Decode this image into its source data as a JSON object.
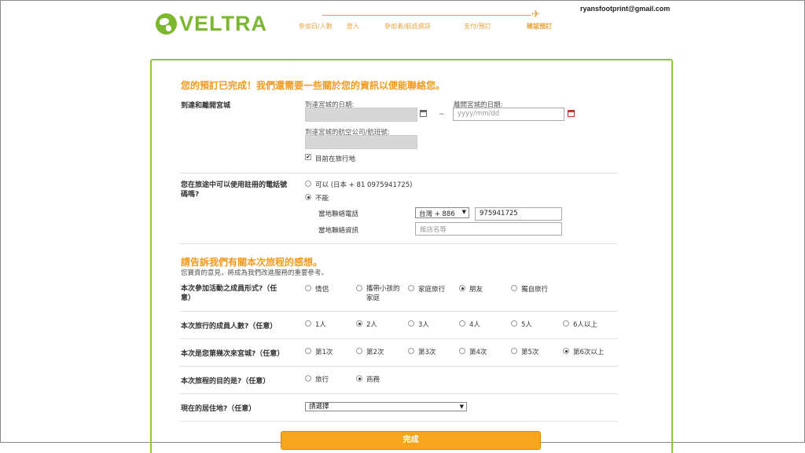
{
  "brand": {
    "logo_text": "VELTRA"
  },
  "user": {
    "email": "ryansfootprint@gmail.com"
  },
  "steps": [
    "參加日/人數",
    "登入",
    "參加者/航班資訊",
    "支付/預訂",
    "確認預訂"
  ],
  "section1": {
    "title": "您的預訂已完成！我們還需要一些關於您的資訊以便能聯絡您。",
    "arrival_label": "到達和離開宮城",
    "arrival_date_label": "到達宮城的日期:",
    "tilde": "~",
    "departure_date_label": "離開宮城的日期:",
    "departure_date_placeholder": "yyyy/mm/dd",
    "airline_label": "到達宮城的航空公司/航班號:",
    "traveling_label": "目前在旅行地",
    "traveling_check": "✔",
    "phone_question": "您在旅途中可以使用註冊的電話號碼嗎?",
    "phone_yes": "可以 (日本 + 81 0975941725)",
    "phone_no": "不能",
    "local_phone_label": "當地聯絡電話",
    "country_code": "台灣 + 886",
    "local_phone_value": "975941725",
    "local_contact_label": "當地聯絡資訊",
    "hotel_placeholder": "飯店名等"
  },
  "section2": {
    "title": "請告訴我們有關本次旅程的感想。",
    "subtitle": "您寶貴的意見，將成為我們改進服務的重要參考。",
    "q_companion": {
      "label": "本次參加活動之成員形式?（任意）",
      "options": [
        "情侶",
        "攜帶小孩的家庭",
        "家庭旅行",
        "朋友",
        "獨自旅行"
      ],
      "selected_index": 3
    },
    "q_group": {
      "label": "本次旅行的成員人數?（任意）",
      "options": [
        "1人",
        "2人",
        "3人",
        "4人",
        "5人",
        "6人以上"
      ],
      "selected_index": 1
    },
    "q_visits": {
      "label": "本次是您第幾次來宮城?（任意）",
      "options": [
        "第1次",
        "第2次",
        "第3次",
        "第4次",
        "第5次",
        "第6次以上"
      ],
      "selected_index": 5
    },
    "q_purpose": {
      "label": "本次旅程的目的是?（任意）",
      "options": [
        "旅行",
        "商務"
      ],
      "selected_index": 1
    },
    "q_residence": {
      "label": "現在的居住地?（任意）",
      "select_value": "請選擇"
    }
  },
  "submit_label": "完成"
}
